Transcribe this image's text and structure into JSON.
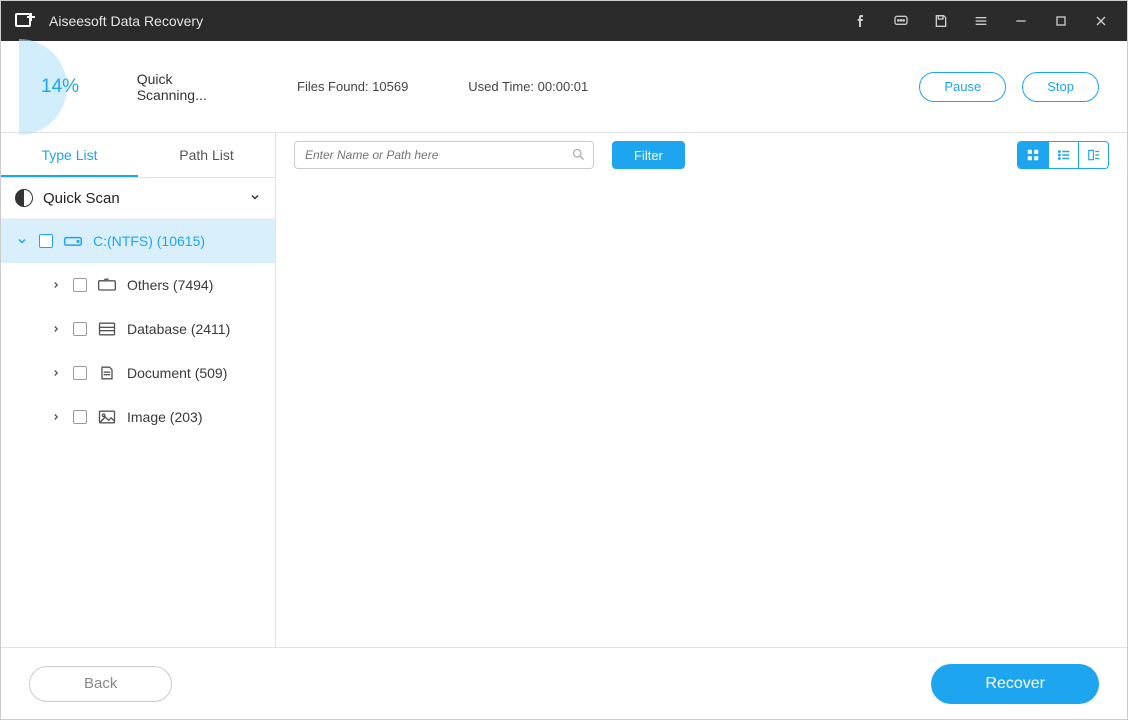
{
  "app": {
    "title": "Aiseesoft Data Recovery"
  },
  "status": {
    "percent": "14%",
    "scan_label": "Quick Scanning...",
    "files_found_label": "Files Found: 10569",
    "used_time_label": "Used Time: 00:00:01",
    "pause_label": "Pause",
    "stop_label": "Stop"
  },
  "sidebar": {
    "tabs": {
      "type_list": "Type List",
      "path_list": "Path List"
    },
    "section": "Quick Scan",
    "drive": "C:(NTFS) (10615)",
    "items": [
      {
        "label": "Others (7494)"
      },
      {
        "label": "Database (2411)"
      },
      {
        "label": "Document (509)"
      },
      {
        "label": "Image (203)"
      }
    ]
  },
  "toolbar": {
    "search_placeholder": "Enter Name or Path here",
    "filter_label": "Filter"
  },
  "footer": {
    "back_label": "Back",
    "recover_label": "Recover"
  }
}
